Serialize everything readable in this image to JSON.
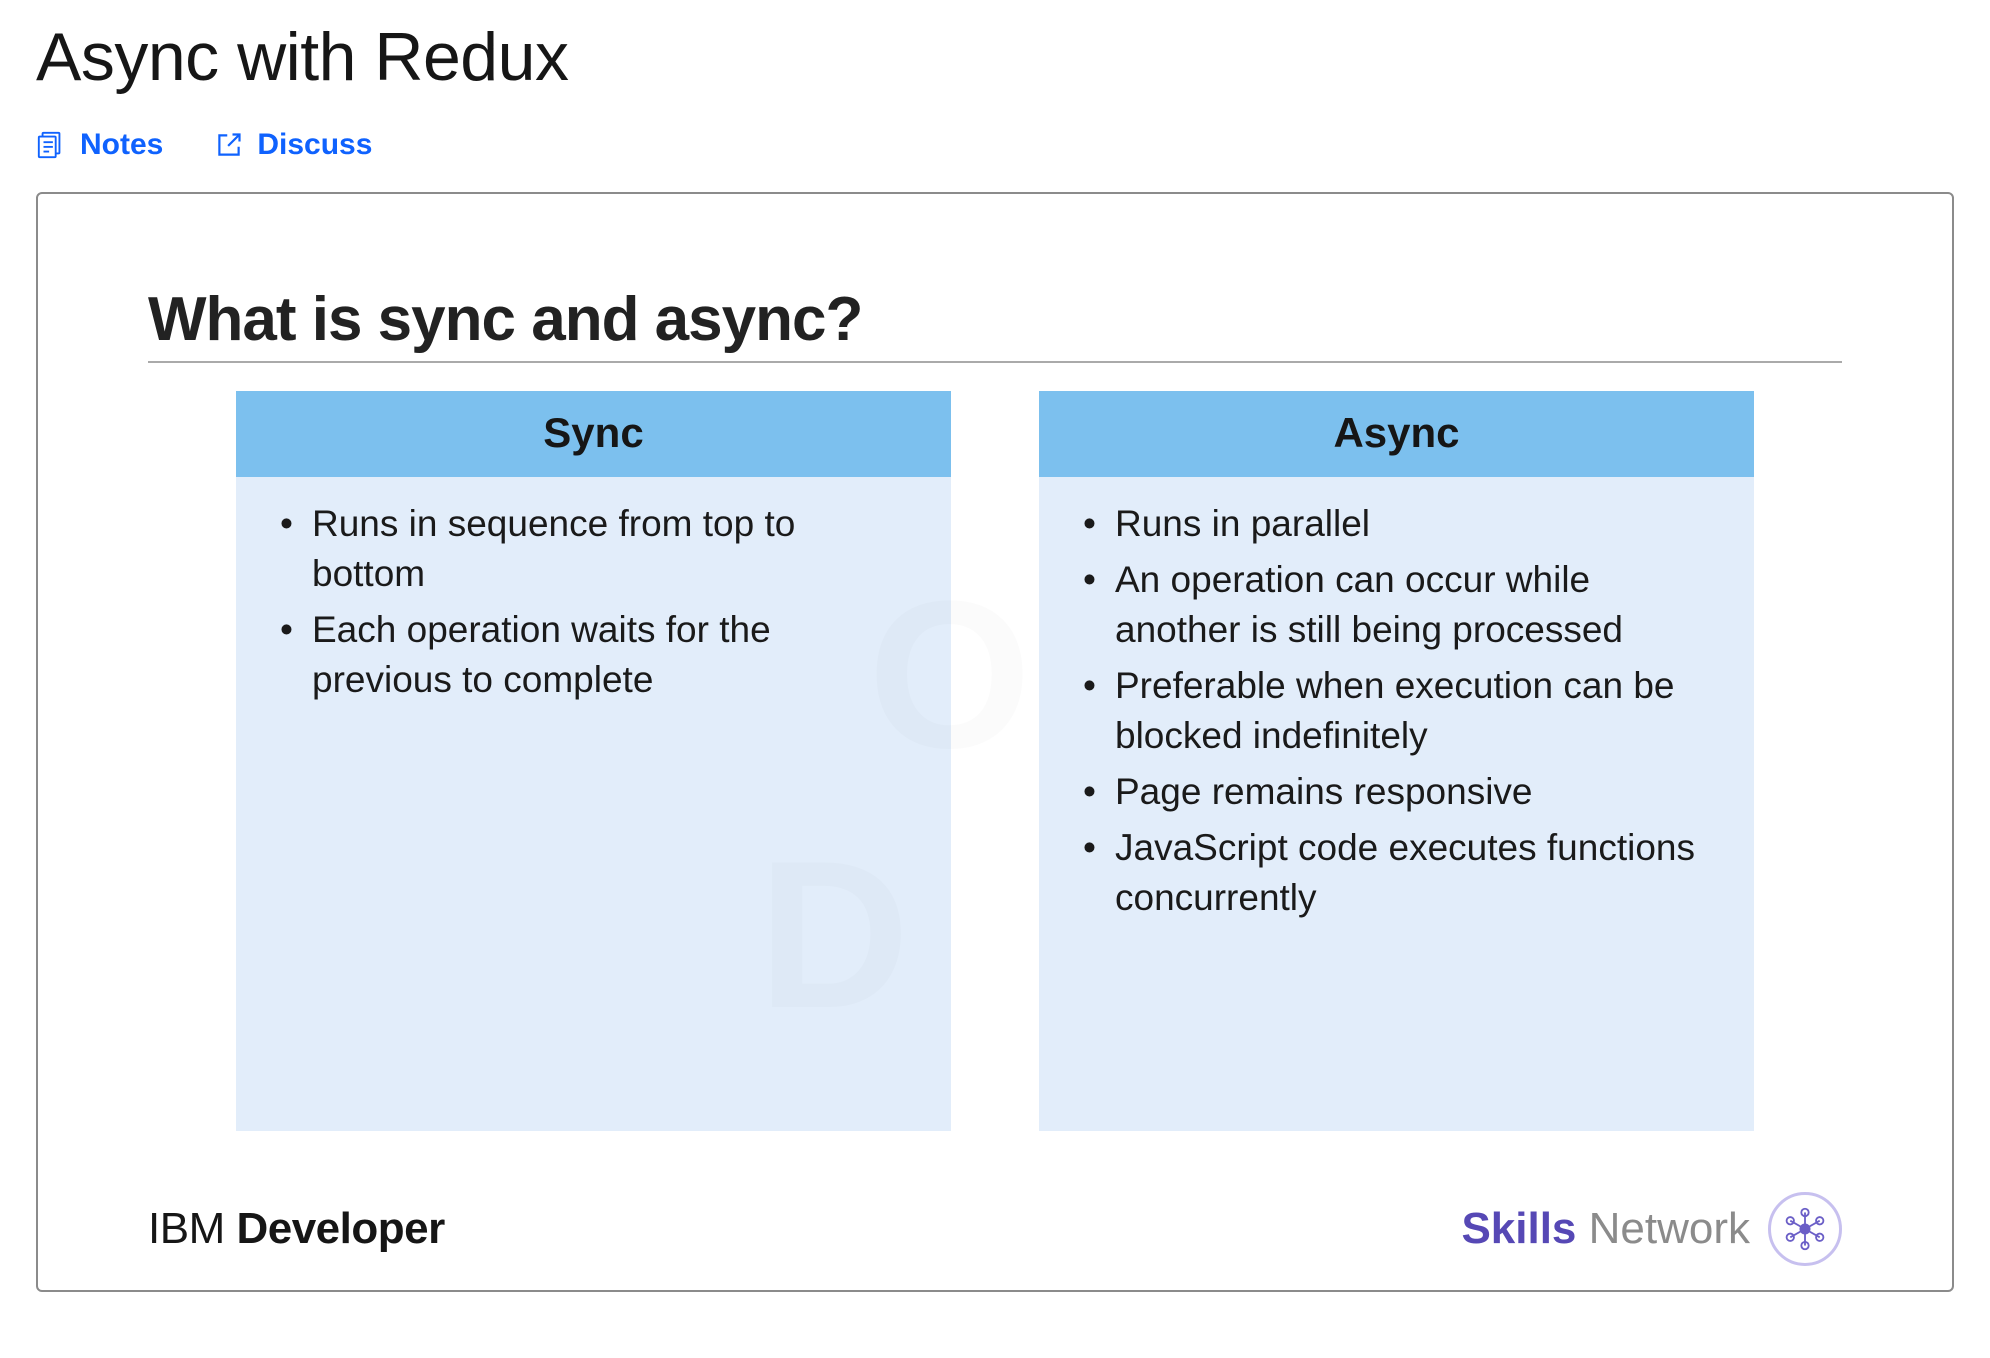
{
  "title": "Async with Redux",
  "actions": {
    "notes": "Notes",
    "discuss": "Discuss"
  },
  "slide": {
    "heading": "What is sync and async?",
    "columns": [
      {
        "header": "Sync",
        "bullets": [
          "Runs in sequence from top to bottom",
          "Each operation waits for the previous to complete"
        ]
      },
      {
        "header": "Async",
        "bullets": [
          "Runs in parallel",
          "An operation can occur while another is still being processed",
          "Preferable when execution can be blocked indefinitely",
          "Page remains responsive",
          "JavaScript code executes functions concurrently"
        ]
      }
    ],
    "footer": {
      "ibm_light": "IBM ",
      "ibm_bold": "Developer",
      "skills": "Skills",
      "network": " Network"
    }
  }
}
